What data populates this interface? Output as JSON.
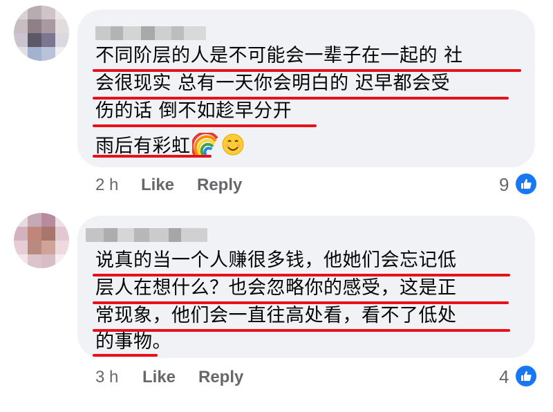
{
  "comments": [
    {
      "lines": [
        "不同阶层的人是不可能会一辈子在一起的  社",
        "会很现实  总有一天你会明白的  迟早都会受",
        "伤的话 倒不如趁早分开",
        "雨后有彩虹"
      ],
      "time": "2 h",
      "like_label": "Like",
      "reply_label": "Reply",
      "reaction_count": "9",
      "emojis": [
        "rainbow-icon",
        "smiley-icon"
      ]
    },
    {
      "lines": [
        "说真的当一个人赚很多钱，他她们会忘记低",
        "层人在想什么？也会忽略你的感受，这是正",
        "常现象，他们会一直往高处看，看不了低处",
        "的事物。"
      ],
      "time": "3 h",
      "like_label": "Like",
      "reply_label": "Reply",
      "reaction_count": "4"
    }
  ],
  "colors": {
    "accent": "#1877f2",
    "underline": "#e8111b",
    "bubble": "#f0f2f5",
    "meta": "#65676b"
  }
}
